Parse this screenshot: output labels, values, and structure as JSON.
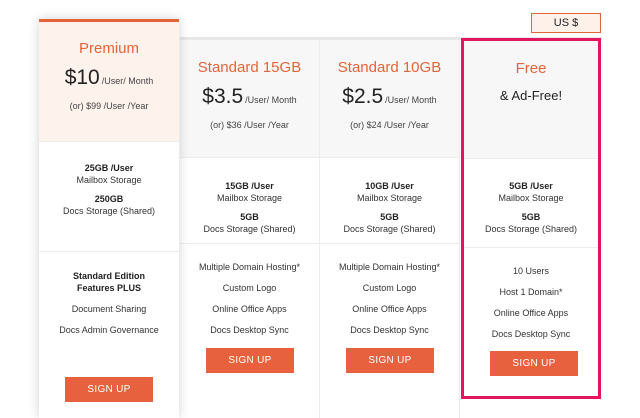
{
  "currency": "US $",
  "plans": [
    {
      "name": "Premium",
      "price": "$10",
      "per": "/User/ Month",
      "yearly": "(or) $99 /User /Year",
      "storage": [
        "25GB /User",
        "Mailbox Storage",
        "250GB",
        "Docs Storage (Shared)"
      ],
      "features_heading": "Standard Edition Features PLUS",
      "features": [
        "Document Sharing",
        "Docs Admin Governance"
      ],
      "cta": "SIGN UP"
    },
    {
      "name": "Standard 15GB",
      "price": "$3.5",
      "per": "/User/ Month",
      "yearly": "(or) $36 /User /Year",
      "storage": [
        "15GB /User",
        "Mailbox Storage",
        "5GB",
        "Docs Storage (Shared)"
      ],
      "features": [
        "Multiple Domain Hosting*",
        "Custom Logo",
        "Online Office Apps",
        "Docs Desktop Sync"
      ],
      "cta": "SIGN UP"
    },
    {
      "name": "Standard 10GB",
      "price": "$2.5",
      "per": "/User/ Month",
      "yearly": "(or) $24 /User /Year",
      "storage": [
        "10GB /User",
        "Mailbox Storage",
        "5GB",
        "Docs Storage (Shared)"
      ],
      "features": [
        "Multiple Domain Hosting*",
        "Custom Logo",
        "Online Office Apps",
        "Docs Desktop Sync"
      ],
      "cta": "SIGN UP"
    },
    {
      "name": "Free",
      "subtitle": "& Ad-Free!",
      "storage": [
        "5GB /User",
        "Mailbox Storage",
        "5GB",
        "Docs Storage (Shared)"
      ],
      "features": [
        "10 Users",
        "Host 1 Domain*",
        "Online Office Apps",
        "Docs Desktop Sync"
      ],
      "cta": "SIGN UP"
    }
  ],
  "colors": {
    "accent": "#e4643a",
    "highlight_border": "#e2165e"
  }
}
